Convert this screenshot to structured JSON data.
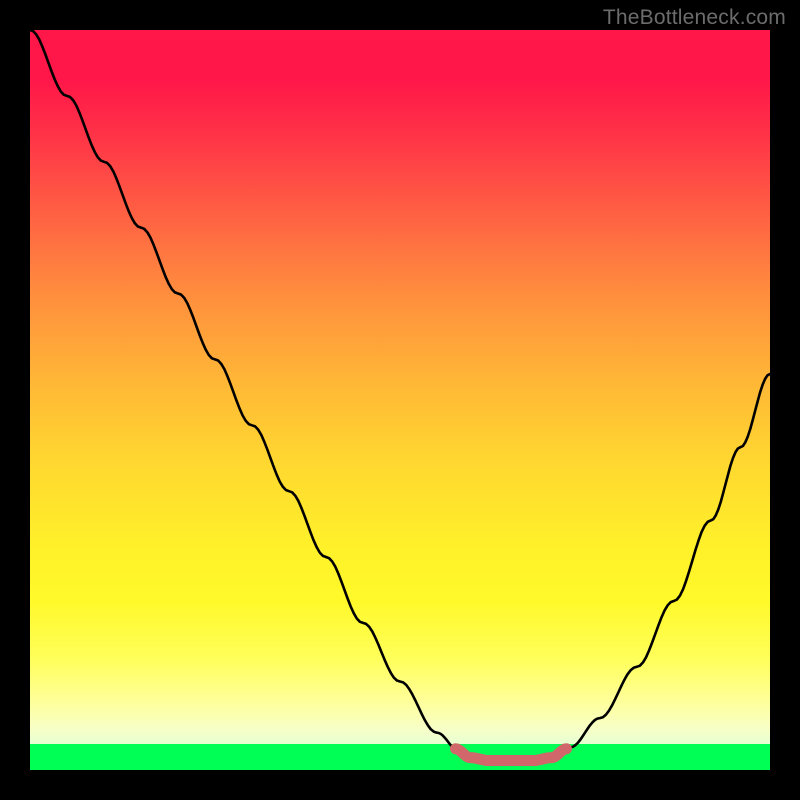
{
  "watermark": "TheBottleneck.com",
  "colors": {
    "frame": "#000000",
    "base": "#00ff55",
    "curve": "#000000",
    "segment": "#d1666b"
  },
  "chart_data": {
    "type": "line",
    "title": "",
    "xlabel": "",
    "ylabel": "",
    "xlim": [
      0,
      1
    ],
    "ylim": [
      0,
      1
    ],
    "series": [
      {
        "name": "bottleneck-curve",
        "x": [
          0.0,
          0.05,
          0.1,
          0.15,
          0.2,
          0.25,
          0.3,
          0.35,
          0.4,
          0.45,
          0.5,
          0.55,
          0.58,
          0.61,
          0.64,
          0.67,
          0.7,
          0.73,
          0.77,
          0.82,
          0.87,
          0.92,
          0.96,
          1.0
        ],
        "y": [
          1.0,
          0.91,
          0.82,
          0.73,
          0.64,
          0.55,
          0.46,
          0.37,
          0.28,
          0.19,
          0.11,
          0.04,
          0.015,
          0.005,
          0.002,
          0.002,
          0.005,
          0.02,
          0.06,
          0.13,
          0.22,
          0.33,
          0.43,
          0.53
        ]
      },
      {
        "name": "optimal-segment",
        "x": [
          0.575,
          0.595,
          0.62,
          0.65,
          0.68,
          0.705,
          0.725
        ],
        "y": [
          0.018,
          0.006,
          0.002,
          0.002,
          0.002,
          0.006,
          0.018
        ]
      }
    ]
  }
}
